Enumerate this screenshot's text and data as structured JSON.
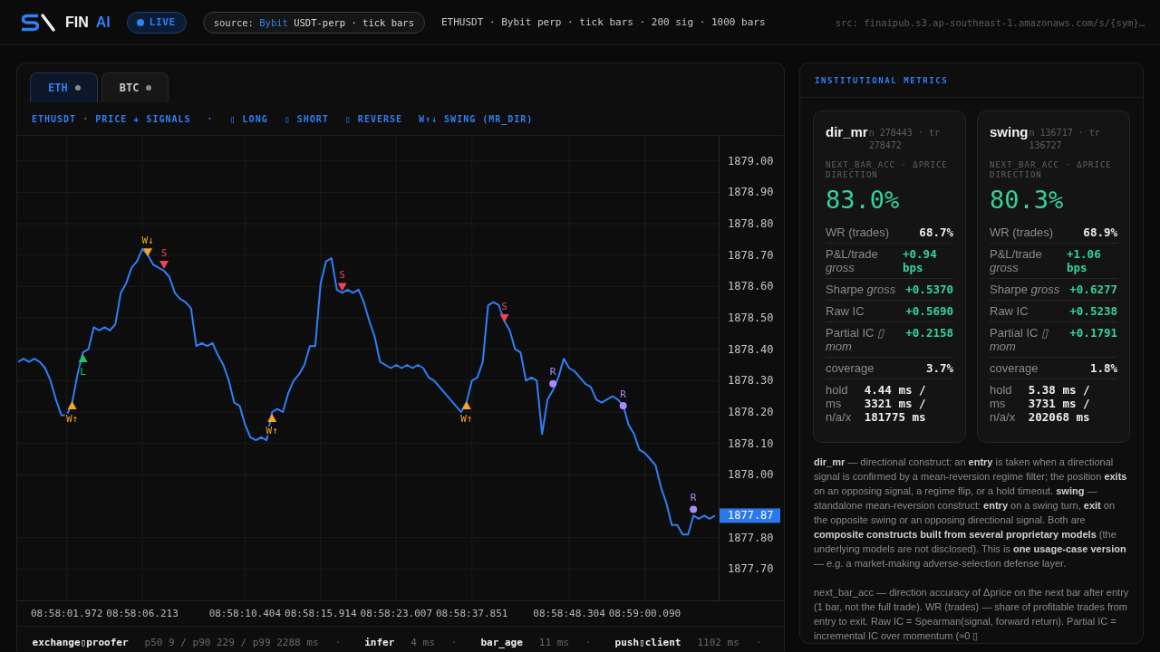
{
  "header": {
    "brand": {
      "name": "FIN",
      "accent": "AI"
    },
    "live_badge": "LIVE",
    "source": {
      "prefix": "source:",
      "exchange": "Bybit",
      "rest": "USDT-perp · tick bars"
    },
    "info": "ETHUSDT · Bybit perp · tick bars · 200 sig · 1000 bars",
    "src": "src: finaipub.s3.ap-southeast-1.amazonaws.com/s/{sym}…"
  },
  "chart_panel": {
    "tabs": [
      {
        "label": "ETH",
        "selected": true
      },
      {
        "label": "BTC",
        "selected": false
      }
    ],
    "caption": "ETHUSDT · PRICE + SIGNALS",
    "caption_separator": "·",
    "legend": [
      "▯ LONG",
      "▯ SHORT",
      "▯ REVERSE",
      "W↑↓ SWING (MR_DIR)"
    ],
    "chart_data": [
      {
        "type": "line",
        "categories": [
          null,
          null,
          null,
          null,
          null,
          null,
          null,
          null,
          null,
          "08:58:01.972",
          null,
          null,
          null,
          null,
          null,
          null,
          null,
          null,
          null,
          null,
          null,
          null,
          null,
          "08:58:06.213",
          null,
          null,
          null,
          null,
          null,
          null,
          null,
          null,
          null,
          null,
          null,
          null,
          null,
          null,
          null,
          null,
          null,
          null,
          "08:58:10.404",
          null,
          null,
          null,
          null,
          null,
          null,
          null,
          null,
          null,
          null,
          null,
          null,
          null,
          "08:58:15.914",
          null,
          null,
          null,
          null,
          null,
          null,
          null,
          null,
          null,
          null,
          null,
          null,
          null,
          "08:58:23.007",
          null,
          null,
          null,
          null,
          null,
          null,
          null,
          null,
          null,
          null,
          null,
          null,
          null,
          "08:58:37.851",
          null,
          null,
          null,
          null,
          null,
          null,
          null,
          null,
          null,
          null,
          null,
          null,
          null,
          null,
          null,
          null,
          null,
          "08:58:48.304",
          null,
          null,
          null,
          null,
          null,
          null,
          null,
          null,
          null,
          null,
          null,
          null,
          null,
          "08:59:00.090",
          null,
          null,
          null,
          null,
          null,
          null,
          null,
          null,
          null,
          null,
          null,
          null,
          null
        ],
        "ylim": [
          1877.6,
          1879.08
        ],
        "yticks": [
          {
            "value": 1879.0,
            "label": "1879.00"
          },
          {
            "value": 1878.9,
            "label": "1878.90"
          },
          {
            "value": 1878.8,
            "label": "1878.80"
          },
          {
            "value": 1878.7,
            "label": "1878.70"
          },
          {
            "value": 1878.6,
            "label": "1878.60"
          },
          {
            "value": 1878.5,
            "label": "1878.50"
          },
          {
            "value": 1878.4,
            "label": "1878.40"
          },
          {
            "value": 1878.3,
            "label": "1878.30"
          },
          {
            "value": 1878.2,
            "label": "1878.20"
          },
          {
            "value": 1878.1,
            "label": "1878.10"
          },
          {
            "value": 1878.0,
            "label": "1878.00"
          },
          {
            "value": 1877.8,
            "label": "1877.80"
          },
          {
            "value": 1877.7,
            "label": "1877.70"
          }
        ],
        "grid": true,
        "series": [
          {
            "type": "line",
            "color": "#2f7ff5",
            "values": [
              1878.36,
              1878.37,
              1878.36,
              1878.37,
              1878.36,
              1878.34,
              1878.3,
              1878.24,
              1878.19,
              1878.19,
              1878.23,
              1878.32,
              1878.39,
              1878.4,
              1878.47,
              1878.46,
              1878.47,
              1878.46,
              1878.48,
              1878.58,
              1878.61,
              1878.66,
              1878.68,
              1878.72,
              1878.7,
              1878.67,
              1878.66,
              1878.65,
              1878.63,
              1878.58,
              1878.56,
              1878.55,
              1878.53,
              1878.41,
              1878.42,
              1878.41,
              1878.42,
              1878.38,
              1878.35,
              1878.3,
              1878.23,
              1878.22,
              1878.16,
              1878.12,
              1878.11,
              1878.12,
              1878.11,
              1878.2,
              1878.21,
              1878.2,
              1878.26,
              1878.3,
              1878.32,
              1878.35,
              1878.41,
              1878.41,
              1878.61,
              1878.68,
              1878.69,
              1878.59,
              1878.58,
              1878.59,
              1878.58,
              1878.59,
              1878.55,
              1878.49,
              1878.44,
              1878.36,
              1878.35,
              1878.34,
              1878.35,
              1878.34,
              1878.35,
              1878.34,
              1878.35,
              1878.34,
              1878.31,
              1878.3,
              1878.28,
              1878.26,
              1878.24,
              1878.22,
              1878.2,
              1878.23,
              1878.3,
              1878.31,
              1878.36,
              1878.54,
              1878.55,
              1878.54,
              1878.49,
              1878.46,
              1878.4,
              1878.39,
              1878.3,
              1878.31,
              1878.3,
              1878.13,
              1878.24,
              1878.27,
              1878.31,
              1878.37,
              1878.34,
              1878.33,
              1878.31,
              1878.29,
              1878.28,
              1878.24,
              1878.23,
              1878.24,
              1878.25,
              1878.24,
              1878.22,
              1878.16,
              1878.13,
              1878.08,
              1878.07,
              1878.05,
              1878.03,
              1877.96,
              1877.91,
              1877.84,
              1877.84,
              1877.81,
              1877.81,
              1877.87,
              1877.86,
              1877.87,
              1877.86,
              1877.87
            ]
          },
          {
            "type": "scatter",
            "marker": "triangle",
            "color": "#22c55e",
            "values": [
              null,
              null,
              null,
              null,
              null,
              null,
              null,
              null,
              null,
              null,
              null,
              null,
              1878.37,
              null,
              null,
              null,
              null,
              null,
              null,
              null,
              null,
              null,
              null,
              null,
              null,
              null,
              null,
              null,
              null,
              null,
              null,
              null,
              null,
              null,
              null,
              null,
              null,
              null,
              null,
              null,
              null,
              null,
              null,
              null,
              null,
              null,
              null,
              null,
              null,
              null,
              null,
              null,
              null,
              null,
              null,
              null,
              null,
              null,
              null,
              null,
              null,
              null,
              null,
              null,
              null,
              null,
              null,
              null,
              null,
              null,
              null,
              null,
              null,
              null,
              null,
              null,
              null,
              null,
              null,
              null,
              null,
              null,
              null,
              null,
              null,
              null,
              null,
              null,
              null,
              null,
              null,
              null,
              null,
              null,
              null,
              null,
              null,
              null,
              null,
              null,
              null,
              null,
              null,
              null,
              null,
              null,
              null,
              null,
              null,
              null,
              null,
              null,
              null,
              null,
              null,
              null,
              null,
              null,
              null,
              null,
              null,
              null,
              null,
              null,
              null,
              null,
              null,
              null,
              null,
              null
            ],
            "value_labels": [
              null,
              null,
              null,
              null,
              null,
              null,
              null,
              null,
              null,
              null,
              null,
              null,
              "L",
              null,
              null,
              null,
              null,
              null,
              null,
              null,
              null,
              null,
              null,
              null,
              null,
              null,
              null,
              null,
              null,
              null,
              null,
              null,
              null,
              null,
              null,
              null,
              null,
              null,
              null,
              null,
              null,
              null,
              null,
              null,
              null,
              null,
              null,
              null,
              null,
              null,
              null,
              null,
              null,
              null,
              null,
              null,
              null,
              null,
              null,
              null,
              null,
              null,
              null,
              null,
              null,
              null,
              null,
              null,
              null,
              null,
              null,
              null,
              null,
              null,
              null,
              null,
              null,
              null,
              null,
              null,
              null,
              null,
              null,
              null,
              null,
              null,
              null,
              null,
              null,
              null,
              null,
              null,
              null,
              null,
              null,
              null,
              null,
              null,
              null,
              null,
              null,
              null,
              null,
              null,
              null,
              null,
              null,
              null,
              null,
              null,
              null,
              null,
              null,
              null,
              null,
              null,
              null,
              null,
              null,
              null,
              null,
              null,
              null,
              null,
              null,
              null,
              null,
              null,
              null,
              null
            ]
          },
          {
            "type": "scatter",
            "marker": "triangle",
            "color": "#f5a524",
            "values": [
              null,
              null,
              null,
              null,
              null,
              null,
              null,
              null,
              null,
              null,
              1878.22,
              null,
              null,
              null,
              null,
              null,
              null,
              null,
              null,
              null,
              null,
              null,
              null,
              null,
              null,
              null,
              null,
              null,
              null,
              null,
              null,
              null,
              null,
              null,
              null,
              null,
              null,
              null,
              null,
              null,
              null,
              null,
              null,
              null,
              null,
              null,
              null,
              1878.18,
              null,
              null,
              null,
              null,
              null,
              null,
              null,
              null,
              null,
              null,
              null,
              null,
              null,
              null,
              null,
              null,
              null,
              null,
              null,
              null,
              null,
              null,
              null,
              null,
              null,
              null,
              null,
              null,
              null,
              null,
              null,
              null,
              null,
              null,
              null,
              1878.22,
              null,
              null,
              null,
              null,
              null,
              null,
              null,
              null,
              null,
              null,
              null,
              null,
              null,
              null,
              null,
              null,
              null,
              null,
              null,
              null,
              null,
              null,
              null,
              null,
              null,
              null,
              null,
              null,
              null,
              null,
              null,
              null,
              null,
              null,
              null,
              null,
              null,
              null,
              null,
              null,
              null,
              null,
              null,
              null,
              null,
              null
            ],
            "value_labels": [
              null,
              null,
              null,
              null,
              null,
              null,
              null,
              null,
              null,
              null,
              "W↑",
              null,
              null,
              null,
              null,
              null,
              null,
              null,
              null,
              null,
              null,
              null,
              null,
              null,
              null,
              null,
              null,
              null,
              null,
              null,
              null,
              null,
              null,
              null,
              null,
              null,
              null,
              null,
              null,
              null,
              null,
              null,
              null,
              null,
              null,
              null,
              null,
              "W↑",
              null,
              null,
              null,
              null,
              null,
              null,
              null,
              null,
              null,
              null,
              null,
              null,
              null,
              null,
              null,
              null,
              null,
              null,
              null,
              null,
              null,
              null,
              null,
              null,
              null,
              null,
              null,
              null,
              null,
              null,
              null,
              null,
              null,
              null,
              null,
              "W↑",
              null,
              null,
              null,
              null,
              null,
              null,
              null,
              null,
              null,
              null,
              null,
              null,
              null,
              null,
              null,
              null,
              null,
              null,
              null,
              null,
              null,
              null,
              null,
              null,
              null,
              null,
              null,
              null,
              null,
              null,
              null,
              null,
              null,
              null,
              null,
              null,
              null,
              null,
              null,
              null,
              null,
              null,
              null,
              null,
              null,
              null
            ]
          },
          {
            "type": "scatter",
            "marker": "triangle",
            "color": "#f5a524",
            "values": [
              null,
              null,
              null,
              null,
              null,
              null,
              null,
              null,
              null,
              null,
              null,
              null,
              null,
              null,
              null,
              null,
              null,
              null,
              null,
              null,
              null,
              null,
              null,
              null,
              1878.71,
              null,
              null,
              null,
              null,
              null,
              null,
              null,
              null,
              null,
              null,
              null,
              null,
              null,
              null,
              null,
              null,
              null,
              null,
              null,
              null,
              null,
              null,
              null,
              null,
              null,
              null,
              null,
              null,
              null,
              null,
              null,
              null,
              null,
              null,
              null,
              null,
              null,
              null,
              null,
              null,
              null,
              null,
              null,
              null,
              null,
              null,
              null,
              null,
              null,
              null,
              null,
              null,
              null,
              null,
              null,
              null,
              null,
              null,
              null,
              null,
              null,
              null,
              null,
              null,
              null,
              null,
              null,
              null,
              null,
              null,
              null,
              null,
              null,
              null,
              null,
              null,
              null,
              null,
              null,
              null,
              null,
              null,
              null,
              null,
              null,
              null,
              null,
              null,
              null,
              null,
              null,
              null,
              null,
              null,
              null,
              null,
              null,
              null,
              null,
              null,
              null,
              null,
              null,
              null,
              null
            ],
            "value_labels": [
              null,
              null,
              null,
              null,
              null,
              null,
              null,
              null,
              null,
              null,
              null,
              null,
              null,
              null,
              null,
              null,
              null,
              null,
              null,
              null,
              null,
              null,
              null,
              null,
              "W↓",
              null,
              null,
              null,
              null,
              null,
              null,
              null,
              null,
              null,
              null,
              null,
              null,
              null,
              null,
              null,
              null,
              null,
              null,
              null,
              null,
              null,
              null,
              null,
              null,
              null,
              null,
              null,
              null,
              null,
              null,
              null,
              null,
              null,
              null,
              null,
              null,
              null,
              null,
              null,
              null,
              null,
              null,
              null,
              null,
              null,
              null,
              null,
              null,
              null,
              null,
              null,
              null,
              null,
              null,
              null,
              null,
              null,
              null,
              null,
              null,
              null,
              null,
              null,
              null,
              null,
              null,
              null,
              null,
              null,
              null,
              null,
              null,
              null,
              null,
              null,
              null,
              null,
              null,
              null,
              null,
              null,
              null,
              null,
              null,
              null,
              null,
              null,
              null,
              null,
              null,
              null,
              null,
              null,
              null,
              null,
              null,
              null,
              null,
              null,
              null,
              null,
              null,
              null,
              null,
              null
            ]
          },
          {
            "type": "scatter",
            "marker": "triangle",
            "color": "#f0435a",
            "values": [
              null,
              null,
              null,
              null,
              null,
              null,
              null,
              null,
              null,
              null,
              null,
              null,
              null,
              null,
              null,
              null,
              null,
              null,
              null,
              null,
              null,
              null,
              null,
              null,
              null,
              null,
              null,
              1878.67,
              null,
              null,
              null,
              null,
              null,
              null,
              null,
              null,
              null,
              null,
              null,
              null,
              null,
              null,
              null,
              null,
              null,
              null,
              null,
              null,
              null,
              null,
              null,
              null,
              null,
              null,
              null,
              null,
              null,
              null,
              null,
              null,
              1878.6,
              null,
              null,
              null,
              null,
              null,
              null,
              null,
              null,
              null,
              null,
              null,
              null,
              null,
              null,
              null,
              null,
              null,
              null,
              null,
              null,
              null,
              null,
              null,
              null,
              null,
              null,
              null,
              null,
              null,
              1878.5,
              null,
              null,
              null,
              null,
              null,
              null,
              null,
              null,
              null,
              null,
              null,
              null,
              null,
              null,
              null,
              null,
              null,
              null,
              null,
              null,
              null,
              null,
              null,
              null,
              null,
              null,
              null,
              null,
              null,
              null,
              null,
              null,
              null,
              null,
              null,
              null,
              null,
              null,
              null
            ],
            "value_labels": [
              null,
              null,
              null,
              null,
              null,
              null,
              null,
              null,
              null,
              null,
              null,
              null,
              null,
              null,
              null,
              null,
              null,
              null,
              null,
              null,
              null,
              null,
              null,
              null,
              null,
              null,
              null,
              "S",
              null,
              null,
              null,
              null,
              null,
              null,
              null,
              null,
              null,
              null,
              null,
              null,
              null,
              null,
              null,
              null,
              null,
              null,
              null,
              null,
              null,
              null,
              null,
              null,
              null,
              null,
              null,
              null,
              null,
              null,
              null,
              null,
              "S",
              null,
              null,
              null,
              null,
              null,
              null,
              null,
              null,
              null,
              null,
              null,
              null,
              null,
              null,
              null,
              null,
              null,
              null,
              null,
              null,
              null,
              null,
              null,
              null,
              null,
              null,
              null,
              null,
              null,
              "S",
              null,
              null,
              null,
              null,
              null,
              null,
              null,
              null,
              null,
              null,
              null,
              null,
              null,
              null,
              null,
              null,
              null,
              null,
              null,
              null,
              null,
              null,
              null,
              null,
              null,
              null,
              null,
              null,
              null,
              null,
              null,
              null,
              null,
              null,
              null,
              null,
              null,
              null,
              null
            ]
          },
          {
            "type": "scatter",
            "marker": "circle",
            "color": "#a78bfa",
            "values": [
              null,
              null,
              null,
              null,
              null,
              null,
              null,
              null,
              null,
              null,
              null,
              null,
              null,
              null,
              null,
              null,
              null,
              null,
              null,
              null,
              null,
              null,
              null,
              null,
              null,
              null,
              null,
              null,
              null,
              null,
              null,
              null,
              null,
              null,
              null,
              null,
              null,
              null,
              null,
              null,
              null,
              null,
              null,
              null,
              null,
              null,
              null,
              null,
              null,
              null,
              null,
              null,
              null,
              null,
              null,
              null,
              null,
              null,
              null,
              null,
              null,
              null,
              null,
              null,
              null,
              null,
              null,
              null,
              null,
              null,
              null,
              null,
              null,
              null,
              null,
              null,
              null,
              null,
              null,
              null,
              null,
              null,
              null,
              null,
              null,
              null,
              null,
              null,
              null,
              null,
              null,
              null,
              null,
              null,
              null,
              null,
              null,
              null,
              null,
              1878.29,
              null,
              null,
              null,
              null,
              null,
              null,
              null,
              null,
              null,
              null,
              null,
              null,
              1878.22,
              null,
              null,
              null,
              null,
              null,
              null,
              null,
              null,
              null,
              null,
              null,
              null,
              1877.89,
              null,
              null,
              null,
              null
            ],
            "value_labels": [
              null,
              null,
              null,
              null,
              null,
              null,
              null,
              null,
              null,
              null,
              null,
              null,
              null,
              null,
              null,
              null,
              null,
              null,
              null,
              null,
              null,
              null,
              null,
              null,
              null,
              null,
              null,
              null,
              null,
              null,
              null,
              null,
              null,
              null,
              null,
              null,
              null,
              null,
              null,
              null,
              null,
              null,
              null,
              null,
              null,
              null,
              null,
              null,
              null,
              null,
              null,
              null,
              null,
              null,
              null,
              null,
              null,
              null,
              null,
              null,
              null,
              null,
              null,
              null,
              null,
              null,
              null,
              null,
              null,
              null,
              null,
              null,
              null,
              null,
              null,
              null,
              null,
              null,
              null,
              null,
              null,
              null,
              null,
              null,
              null,
              null,
              null,
              null,
              null,
              null,
              null,
              null,
              null,
              null,
              null,
              null,
              null,
              null,
              null,
              "R",
              null,
              null,
              null,
              null,
              null,
              null,
              null,
              null,
              null,
              null,
              null,
              null,
              "R",
              null,
              null,
              null,
              null,
              null,
              null,
              null,
              null,
              null,
              null,
              null,
              null,
              "R",
              null,
              null,
              null,
              null
            ]
          }
        ]
      }
    ],
    "last_price": "1877.87",
    "latency": [
      {
        "name": "exchange▯proofer",
        "value": "p50 9 / p90 229 / p99 2288 ms",
        "separator": "·"
      },
      {
        "name": "infer",
        "value": "4 ms",
        "separator": "·"
      },
      {
        "name": "bar_age",
        "value": "11 ms",
        "separator": "·"
      },
      {
        "name": "push▯client",
        "value": "1102 ms",
        "separator": "·"
      }
    ]
  },
  "metrics_panel": {
    "title": "INSTITUTIONAL METRICS",
    "cards": [
      {
        "title": "dir_mr",
        "meta": "n 278443 · tr 278472",
        "caption": "NEXT_BAR_ACC · ΔPRICE DIRECTION",
        "headline": "83.0%",
        "rows": [
          {
            "label": "WR (trades)",
            "value": "68.7%",
            "positive": false
          },
          {
            "label": "P&L/trade *gross*",
            "value": "+0.94 bps",
            "positive": true
          },
          {
            "label": "Sharpe *gross*",
            "value": "+0.5370",
            "positive": true
          },
          {
            "label": "Raw IC",
            "value": "+0.5690",
            "positive": true
          },
          {
            "label": "Partial IC *▯ mom*",
            "value": "+0.2158",
            "positive": true
          },
          {
            "label": "coverage",
            "value": "3.7%",
            "positive": false
          },
          {
            "label": "hold ms n/a/x",
            "value": "4.44 ms / 3321 ms / 181775 ms",
            "positive": false
          }
        ]
      },
      {
        "title": "swing",
        "meta": "n 136717 · tr 136727",
        "caption": "NEXT_BAR_ACC · ΔPRICE DIRECTION",
        "headline": "80.3%",
        "rows": [
          {
            "label": "WR (trades)",
            "value": "68.9%",
            "positive": false
          },
          {
            "label": "P&L/trade *gross*",
            "value": "+1.06 bps",
            "positive": true
          },
          {
            "label": "Sharpe *gross*",
            "value": "+0.6277",
            "positive": true
          },
          {
            "label": "Raw IC",
            "value": "+0.5238",
            "positive": true
          },
          {
            "label": "Partial IC *▯ mom*",
            "value": "+0.1791",
            "positive": true
          },
          {
            "label": "coverage",
            "value": "1.8%",
            "positive": false
          },
          {
            "label": "hold ms n/a/x",
            "value": "5.38 ms / 3731 ms / 202068 ms",
            "positive": false
          }
        ]
      }
    ],
    "notes": [
      "**dir_mr** — directional construct: an **entry** is taken when a directional signal is confirmed by a mean-reversion regime filter; the position **exits** on an opposing signal, a regime flip, or a hold timeout. **swing** — standalone mean-reversion construct: **entry** on a swing turn, **exit** on the opposite swing or an opposing directional signal. Both are **composite constructs built from several proprietary models** (the underlying models are not disclosed). This is **one usage-case version** — e.g. a market-making adverse-selection defense layer.",
      "next_bar_acc — direction accuracy of Δprice on the next bar after entry (1 bar, not the full trade). WR (trades) — share of profitable trades from entry to exit. Raw IC = Spearman(signal, forward return). Partial IC = incremental IC over momentum (≈0 ▯"
    ]
  }
}
